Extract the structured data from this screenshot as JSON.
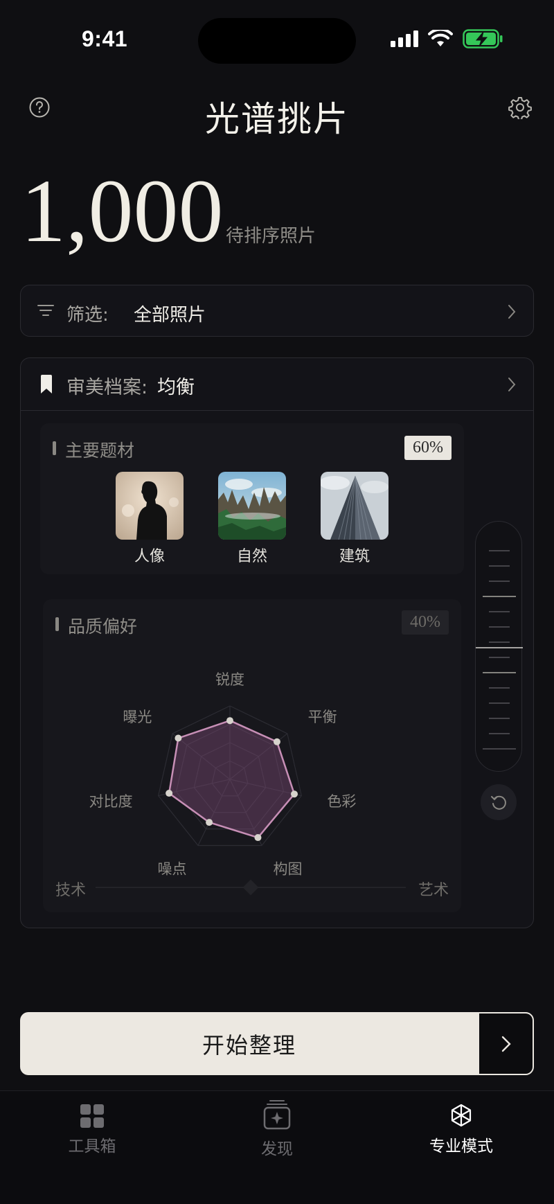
{
  "status": {
    "time": "9:41"
  },
  "header": {
    "title": "光谱挑片",
    "help_icon": "question-circle-icon",
    "settings_icon": "gear-icon"
  },
  "summary": {
    "count": "1,000",
    "label": "待排序照片"
  },
  "filter": {
    "label": "筛选:",
    "value": "全部照片"
  },
  "profile": {
    "label": "审美档案:",
    "value": "均衡"
  },
  "subjects": {
    "title": "主要题材",
    "percent": "60%",
    "items": [
      {
        "label": "人像",
        "icon": "portrait-photo"
      },
      {
        "label": "自然",
        "icon": "nature-photo"
      },
      {
        "label": "建筑",
        "icon": "architecture-photo"
      }
    ]
  },
  "quality": {
    "title": "品质偏好",
    "percent": "40%",
    "axis_left": "技术",
    "axis_right": "艺术"
  },
  "chart_data": {
    "type": "radar",
    "categories": [
      "锐度",
      "平衡",
      "色彩",
      "构图",
      "噪点",
      "对比度",
      "曝光"
    ],
    "values": [
      0.8,
      0.82,
      0.9,
      0.88,
      0.65,
      0.85,
      0.9
    ],
    "range": [
      0,
      1
    ],
    "grid_levels": 4,
    "colors": {
      "fill": "#7a4a74",
      "stroke": "#c78fb6",
      "point": "#d6d3cc"
    }
  },
  "primary_action": {
    "label": "开始整理"
  },
  "tabs": [
    {
      "label": "工具箱",
      "icon": "grid-icon",
      "active": false
    },
    {
      "label": "发现",
      "icon": "sparkle-stack-icon",
      "active": false
    },
    {
      "label": "专业模式",
      "icon": "aperture-icon",
      "active": true
    }
  ],
  "colors": {
    "background": "#0f0f12",
    "accent_light": "#ece8e1",
    "battery": "#35c759"
  }
}
